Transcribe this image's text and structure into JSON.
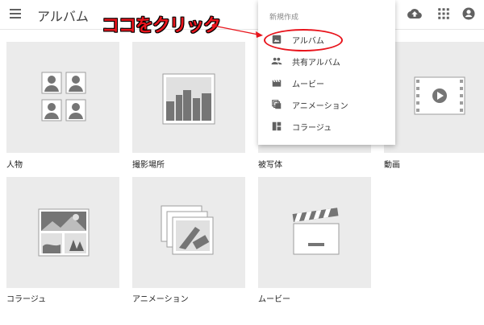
{
  "header": {
    "title": "アルバム",
    "menu_icon": "hamburger-icon",
    "upload_icon": "cloud-upload-icon",
    "apps_icon": "apps-grid-icon",
    "account_icon": "account-icon"
  },
  "annotation": {
    "text": "ココをクリック",
    "color": "#e8141c"
  },
  "menu": {
    "header": "新規作成",
    "items": [
      {
        "label": "アルバム",
        "icon": "photo-album-icon",
        "highlighted": true
      },
      {
        "label": "共有アルバム",
        "icon": "people-icon",
        "highlighted": false
      },
      {
        "label": "ムービー",
        "icon": "movie-icon",
        "highlighted": false
      },
      {
        "label": "アニメーション",
        "icon": "animation-icon",
        "highlighted": false
      },
      {
        "label": "コラージュ",
        "icon": "collage-icon",
        "highlighted": false
      }
    ]
  },
  "tiles": [
    {
      "label": "人物",
      "icon": "people-portraits-icon"
    },
    {
      "label": "撮影場所",
      "icon": "cityscape-icon"
    },
    {
      "label": "被写体",
      "icon": "subject-icon"
    },
    {
      "label": "動画",
      "icon": "video-play-icon"
    },
    {
      "label": "コラージュ",
      "icon": "collage-tile-icon"
    },
    {
      "label": "アニメーション",
      "icon": "animation-tile-icon"
    },
    {
      "label": "ムービー",
      "icon": "clapperboard-icon"
    }
  ],
  "colors": {
    "tile_bg": "#ebebeb",
    "icon_gray": "#757575",
    "accent_red": "#e8141c"
  }
}
